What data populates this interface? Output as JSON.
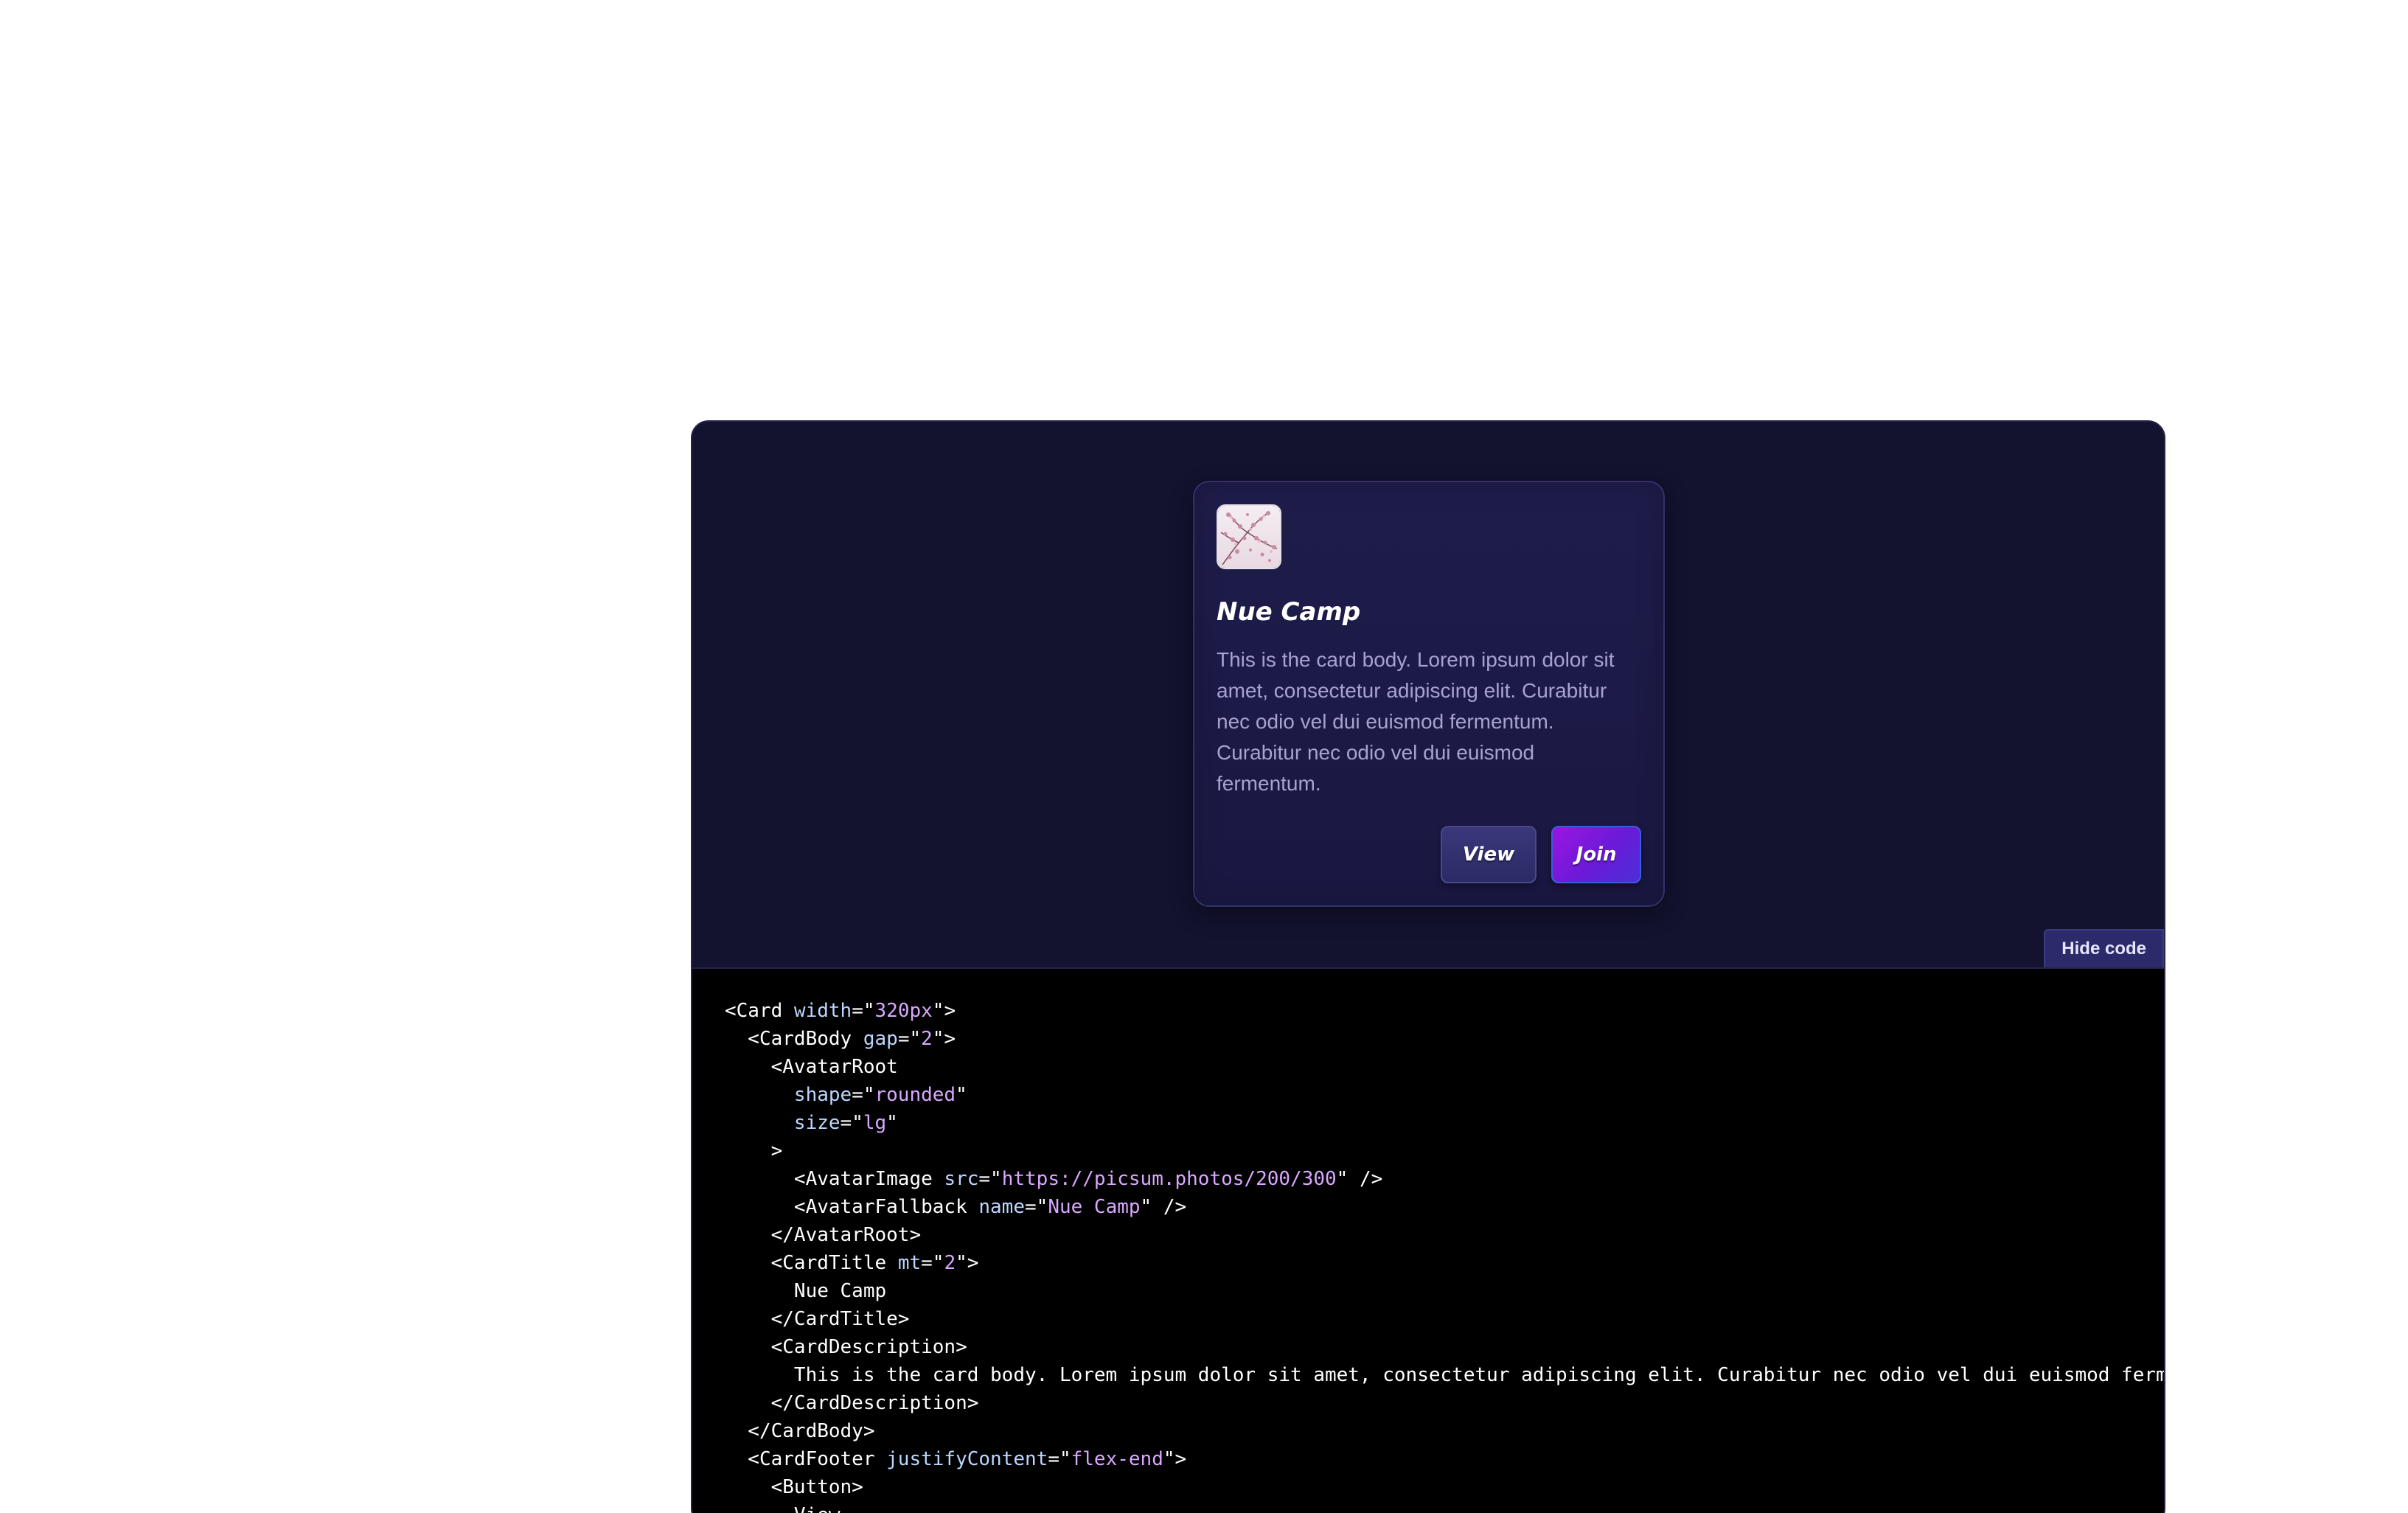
{
  "card": {
    "title": "Nue Camp",
    "description": "This is the card body. Lorem ipsum dolor sit amet, consectetur adipiscing elit. Curabitur nec odio vel dui euismod fermentum. Curabitur nec odio vel dui euismod fermentum.",
    "view_label": "View",
    "join_label": "Join",
    "avatar_icon": "blossom-photo-icon"
  },
  "toolbar": {
    "hide_code_label": "Hide code"
  },
  "code_lines": [
    [
      {
        "t": "tag",
        "v": "<Card "
      },
      {
        "t": "attr",
        "v": "width"
      },
      {
        "t": "tag",
        "v": "=\""
      },
      {
        "t": "val",
        "v": "320px"
      },
      {
        "t": "tag",
        "v": "\">"
      }
    ],
    [
      {
        "t": "tag",
        "v": "  <CardBody "
      },
      {
        "t": "attr",
        "v": "gap"
      },
      {
        "t": "tag",
        "v": "=\""
      },
      {
        "t": "val",
        "v": "2"
      },
      {
        "t": "tag",
        "v": "\">"
      }
    ],
    [
      {
        "t": "tag",
        "v": "    <AvatarRoot"
      }
    ],
    [
      {
        "t": "attr",
        "v": "      shape"
      },
      {
        "t": "tag",
        "v": "=\""
      },
      {
        "t": "val",
        "v": "rounded"
      },
      {
        "t": "tag",
        "v": "\""
      }
    ],
    [
      {
        "t": "attr",
        "v": "      size"
      },
      {
        "t": "tag",
        "v": "=\""
      },
      {
        "t": "val",
        "v": "lg"
      },
      {
        "t": "tag",
        "v": "\""
      }
    ],
    [
      {
        "t": "tag",
        "v": "    >"
      }
    ],
    [
      {
        "t": "tag",
        "v": "      <AvatarImage "
      },
      {
        "t": "attr",
        "v": "src"
      },
      {
        "t": "tag",
        "v": "=\""
      },
      {
        "t": "val",
        "v": "https://picsum.photos/200/300"
      },
      {
        "t": "tag",
        "v": "\" />"
      }
    ],
    [
      {
        "t": "tag",
        "v": "      <AvatarFallback "
      },
      {
        "t": "attr",
        "v": "name"
      },
      {
        "t": "tag",
        "v": "=\""
      },
      {
        "t": "val",
        "v": "Nue Camp"
      },
      {
        "t": "tag",
        "v": "\" />"
      }
    ],
    [
      {
        "t": "tag",
        "v": "    </AvatarRoot>"
      }
    ],
    [
      {
        "t": "tag",
        "v": "    <CardTitle "
      },
      {
        "t": "attr",
        "v": "mt"
      },
      {
        "t": "tag",
        "v": "=\""
      },
      {
        "t": "val",
        "v": "2"
      },
      {
        "t": "tag",
        "v": "\">"
      }
    ],
    [
      {
        "t": "txt",
        "v": "      Nue Camp"
      }
    ],
    [
      {
        "t": "tag",
        "v": "    </CardTitle>"
      }
    ],
    [
      {
        "t": "tag",
        "v": "    <CardDescription>"
      }
    ],
    [
      {
        "t": "txt",
        "v": "      This is the card body. Lorem ipsum dolor sit amet, consectetur adipiscing elit. Curabitur nec odio vel dui euismod ferme"
      }
    ],
    [
      {
        "t": "tag",
        "v": "    </CardDescription>"
      }
    ],
    [
      {
        "t": "tag",
        "v": "  </CardBody>"
      }
    ],
    [
      {
        "t": "tag",
        "v": "  <CardFooter "
      },
      {
        "t": "attr",
        "v": "justifyContent"
      },
      {
        "t": "tag",
        "v": "=\""
      },
      {
        "t": "val",
        "v": "flex-end"
      },
      {
        "t": "tag",
        "v": "\">"
      }
    ],
    [
      {
        "t": "tag",
        "v": "    <Button>"
      }
    ],
    [
      {
        "t": "txt",
        "v": "      View"
      }
    ]
  ],
  "colors": {
    "frame_bg": "#13122f",
    "card_bg": "#1c1a46",
    "join_gradient_start": "#9a16e0",
    "join_gradient_end": "#4b2fd8",
    "code_bg": "#000000",
    "code_attr": "#bcd6ff",
    "code_value": "#d9a7ff"
  }
}
